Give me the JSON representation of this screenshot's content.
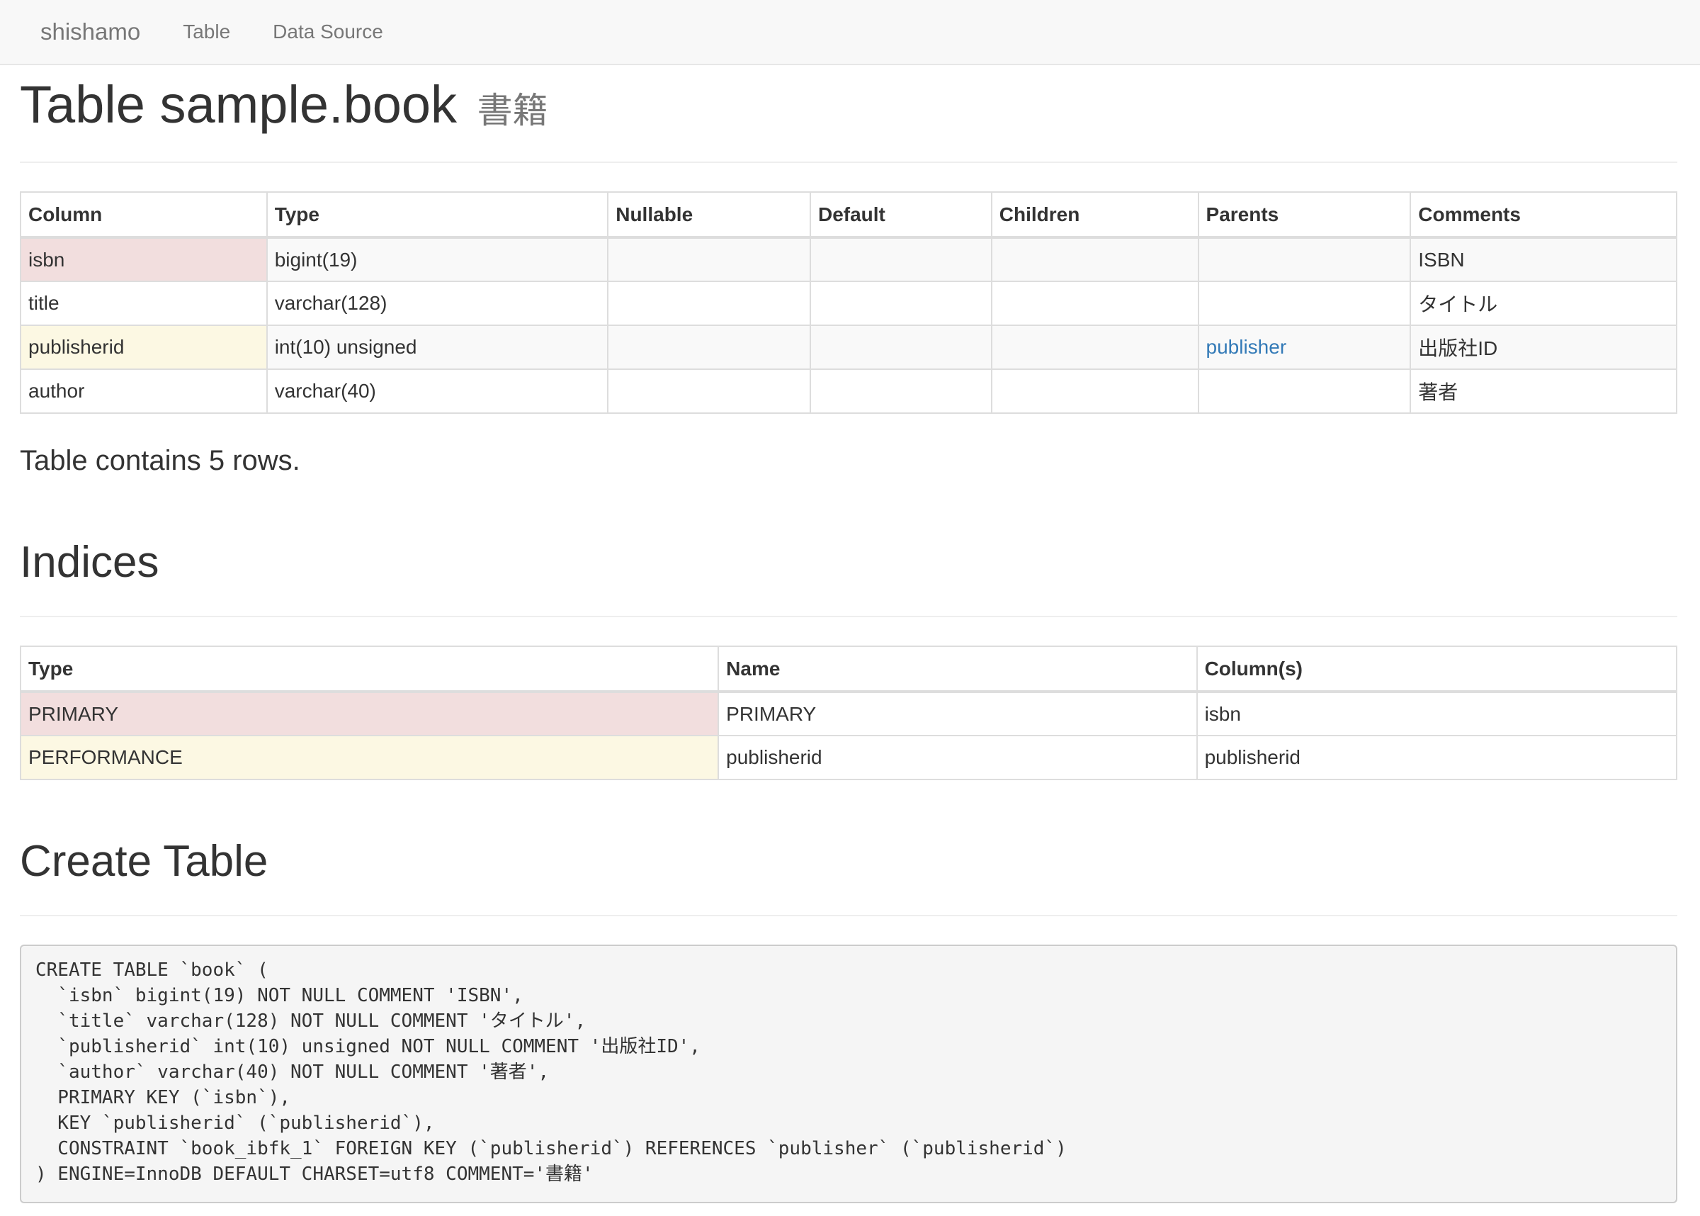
{
  "navbar": {
    "brand": "shishamo",
    "links": [
      "Table",
      "Data Source"
    ]
  },
  "page": {
    "title": "Table sample.book",
    "subtitle": "書籍"
  },
  "columns_table": {
    "headers": [
      "Column",
      "Type",
      "Nullable",
      "Default",
      "Children",
      "Parents",
      "Comments"
    ],
    "rows": [
      {
        "column": "isbn",
        "type": "bigint(19)",
        "nullable": "",
        "default": "",
        "children": "",
        "parents": "",
        "comments": "ISBN"
      },
      {
        "column": "title",
        "type": "varchar(128)",
        "nullable": "",
        "default": "",
        "children": "",
        "parents": "",
        "comments": "タイトル"
      },
      {
        "column": "publisherid",
        "type": "int(10) unsigned",
        "nullable": "",
        "default": "",
        "children": "",
        "parents": "publisher",
        "comments": "出版社ID"
      },
      {
        "column": "author",
        "type": "varchar(40)",
        "nullable": "",
        "default": "",
        "children": "",
        "parents": "",
        "comments": "著者"
      }
    ]
  },
  "row_count_text": "Table contains 5 rows.",
  "indices": {
    "heading": "Indices",
    "headers": [
      "Type",
      "Name",
      "Column(s)"
    ],
    "rows": [
      {
        "type": "PRIMARY",
        "name": "PRIMARY",
        "columns": "isbn"
      },
      {
        "type": "PERFORMANCE",
        "name": "publisherid",
        "columns": "publisherid"
      }
    ]
  },
  "create_table": {
    "heading": "Create Table",
    "sql": "CREATE TABLE `book` (\n  `isbn` bigint(19) NOT NULL COMMENT 'ISBN',\n  `title` varchar(128) NOT NULL COMMENT 'タイトル',\n  `publisherid` int(10) unsigned NOT NULL COMMENT '出版社ID',\n  `author` varchar(40) NOT NULL COMMENT '著者',\n  PRIMARY KEY (`isbn`),\n  KEY `publisherid` (`publisherid`),\n  CONSTRAINT `book_ibfk_1` FOREIGN KEY (`publisherid`) REFERENCES `publisher` (`publisherid`)\n) ENGINE=InnoDB DEFAULT CHARSET=utf8 COMMENT='書籍'"
  },
  "colors": {
    "primary_key_row": "#f2dede",
    "index_row": "#fcf8e3",
    "link": "#337ab7"
  }
}
